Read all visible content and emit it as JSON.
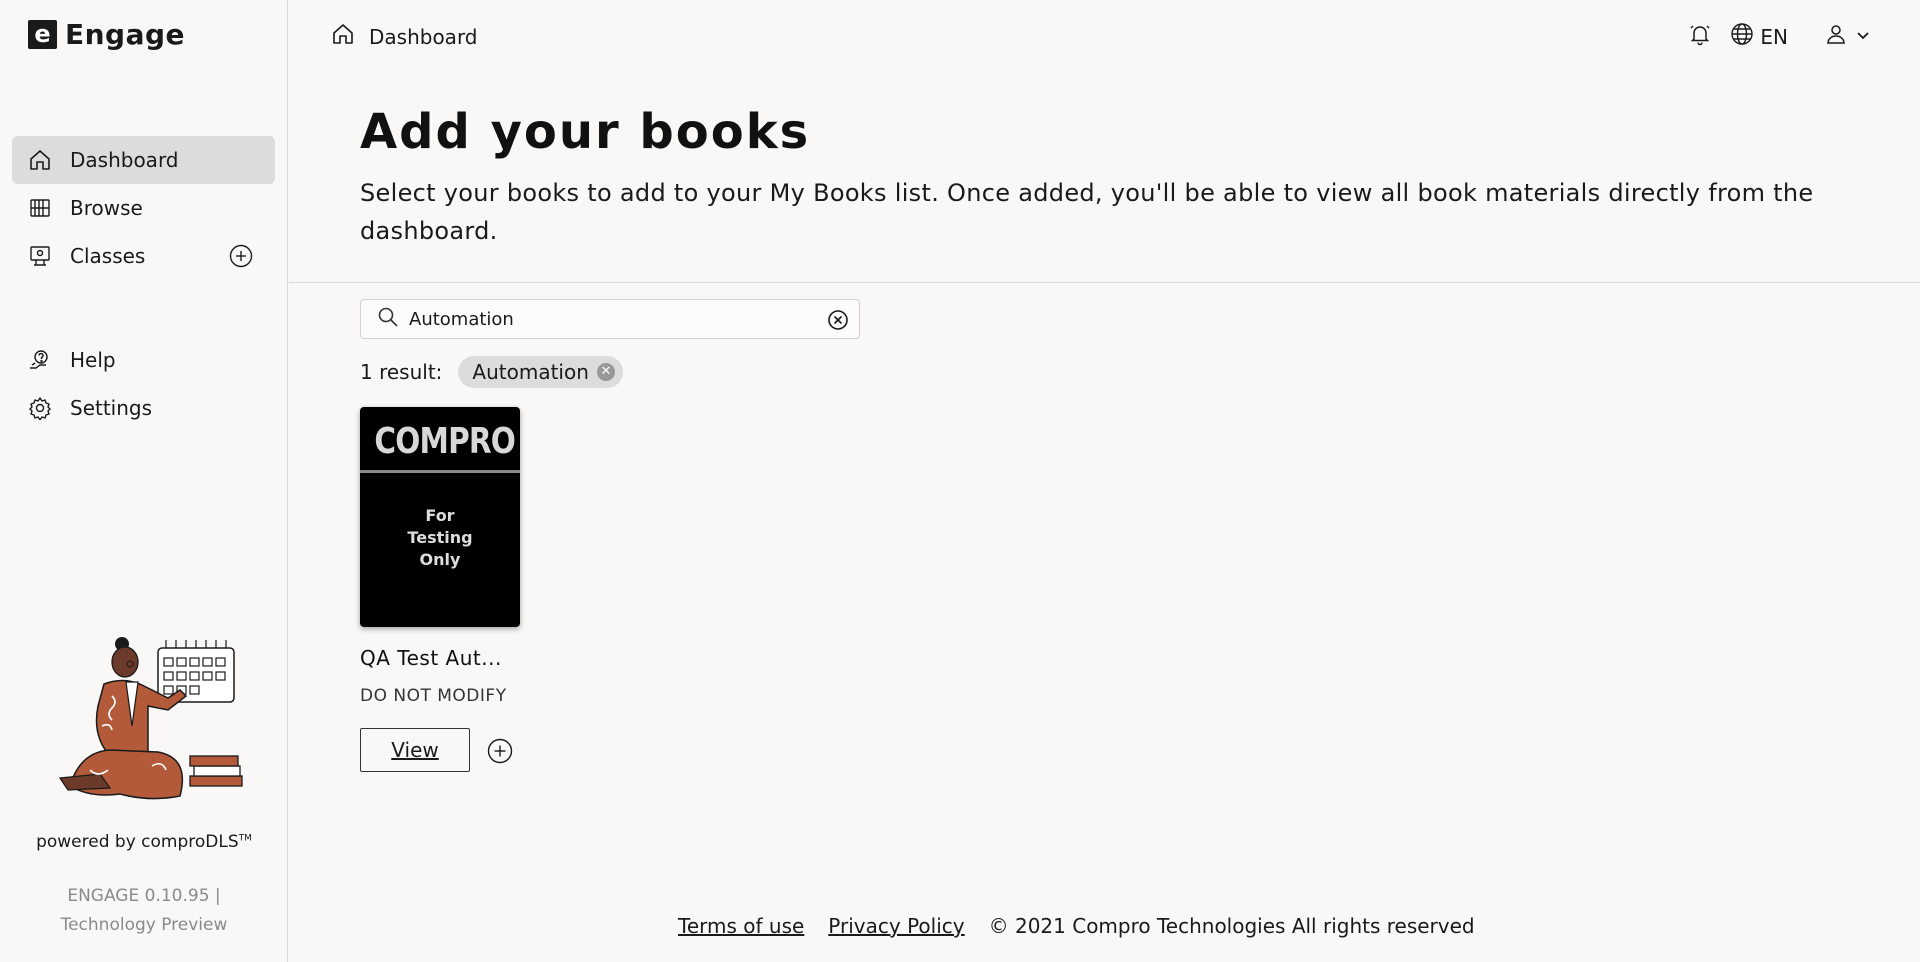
{
  "app": {
    "logo_letter": "e",
    "name": "Engage"
  },
  "sidebar": {
    "items": [
      {
        "label": "Dashboard",
        "icon": "home-icon",
        "active": true
      },
      {
        "label": "Browse",
        "icon": "library-icon"
      },
      {
        "label": "Classes",
        "icon": "classroom-icon"
      }
    ],
    "lower_items": [
      {
        "label": "Help",
        "icon": "help-icon"
      },
      {
        "label": "Settings",
        "icon": "gear-icon"
      }
    ],
    "powered_by": "powered by",
    "powered_brand": "comproDLS",
    "trademark": "TM",
    "version": "ENGAGE 0.10.95 |",
    "version_note": "Technology Preview"
  },
  "header": {
    "breadcrumb": "Dashboard",
    "language": "EN"
  },
  "main": {
    "title": "Add your books",
    "description": "Select your books to add to your My Books list. Once added, you'll be able to view all book materials directly from the dashboard.",
    "search": {
      "value": "Automation",
      "placeholder": ""
    },
    "results_label": "1 result:",
    "filter_chip": "Automation",
    "books": [
      {
        "cover_brand": "COMPRO",
        "cover_line1": "For",
        "cover_line2": "Testing",
        "cover_line3": "Only",
        "title": "QA Test Aut...",
        "subtitle": "DO NOT MODIFY",
        "view_label": "View"
      }
    ]
  },
  "footer": {
    "terms": "Terms of use",
    "privacy": "Privacy Policy",
    "copyright": "© 2021 Compro Technologies All rights reserved"
  },
  "colors": {
    "background": "#f9f8f7",
    "active_nav": "#dedcda",
    "illustration_brown": "#b35a3a"
  }
}
